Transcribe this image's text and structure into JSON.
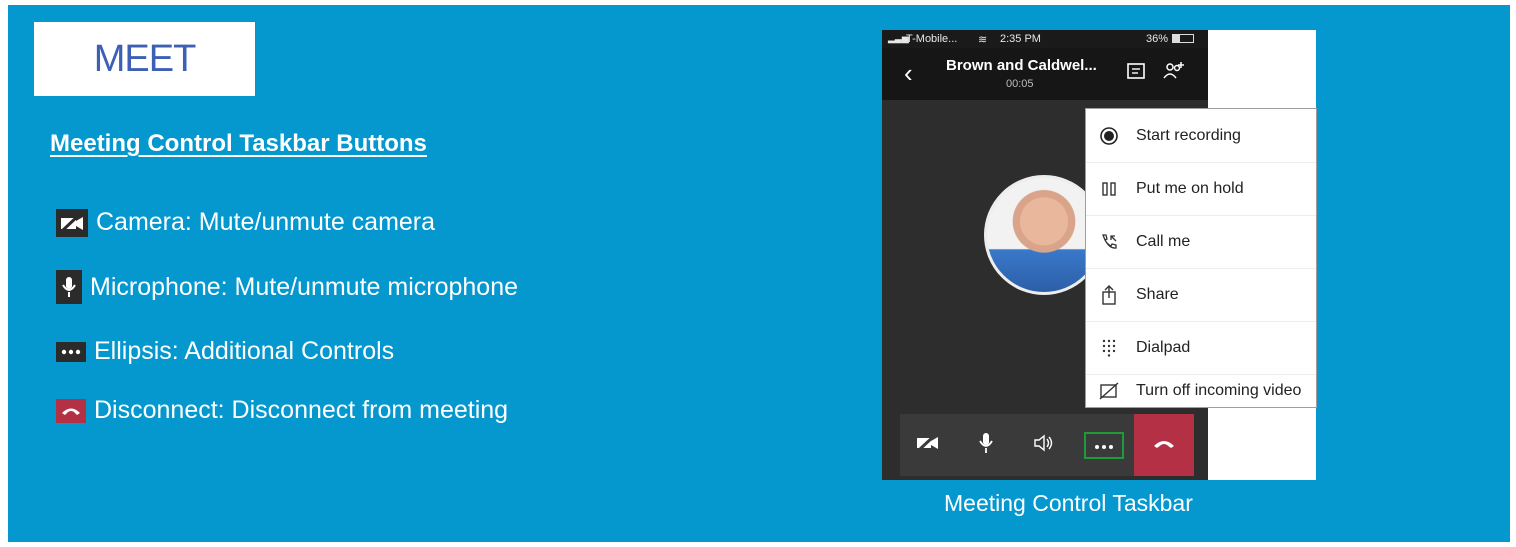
{
  "slide": {
    "title": "MEET",
    "heading": "Meeting Control Taskbar Buttons",
    "legend": [
      {
        "icon": "camera-off-icon",
        "text": "Camera: Mute/unmute camera"
      },
      {
        "icon": "microphone-icon",
        "text": "Microphone: Mute/unmute microphone"
      },
      {
        "icon": "ellipsis-icon",
        "text": "Ellipsis: Additional Controls"
      },
      {
        "icon": "hang-up-icon",
        "text": "Disconnect: Disconnect from meeting"
      }
    ],
    "caption": "Meeting Control Taskbar"
  },
  "phone": {
    "status": {
      "carrier": "T-Mobile...",
      "time": "2:35 PM",
      "battery": "36%"
    },
    "header": {
      "title": "Brown and Caldwel...",
      "timer": "00:05"
    },
    "menu": [
      {
        "icon": "record-icon",
        "label": "Start recording"
      },
      {
        "icon": "hold-icon",
        "label": "Put me on hold"
      },
      {
        "icon": "call-me-icon",
        "label": "Call me"
      },
      {
        "icon": "share-icon",
        "label": "Share"
      },
      {
        "icon": "dialpad-icon",
        "label": "Dialpad"
      },
      {
        "icon": "video-off-icon",
        "label": "Turn off incoming video"
      }
    ],
    "taskbar": [
      "camera-off-icon",
      "microphone-icon",
      "speaker-icon",
      "ellipsis-icon",
      "hang-up-icon"
    ]
  },
  "colors": {
    "background": "#0598cf",
    "hangup": "#b43045",
    "title": "#3d5fb4",
    "highlight": "#1e9a3a"
  }
}
